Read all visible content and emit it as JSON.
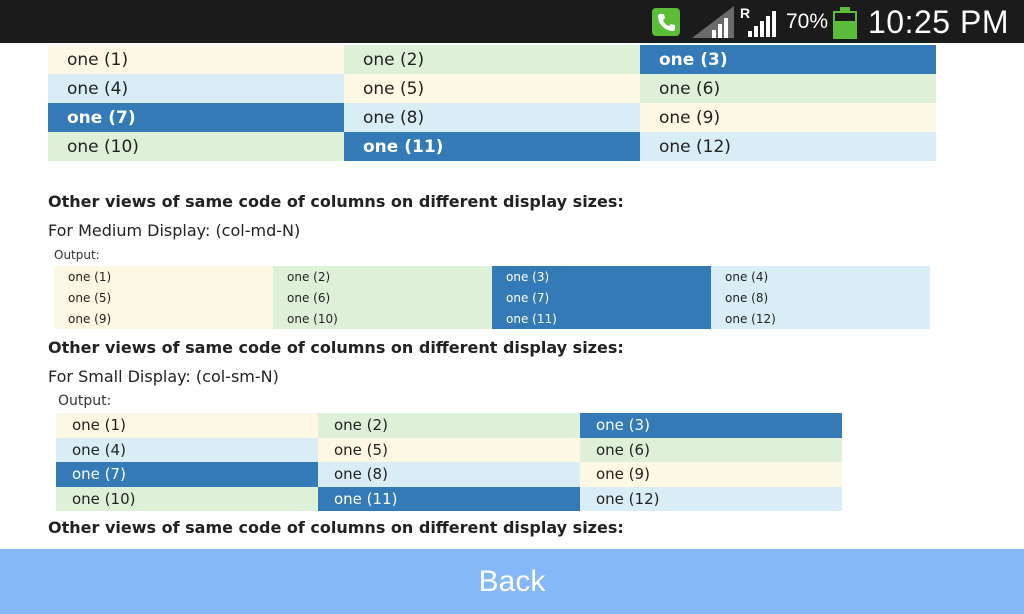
{
  "status_bar": {
    "battery_percent": "70%",
    "time": "10:25 PM",
    "roaming_indicator": "R",
    "icons": [
      "phone-call-icon",
      "wifi-icon",
      "signal-icon",
      "battery-icon"
    ],
    "colors": {
      "background": "#1b1b1b",
      "accent": "#5bbd3a"
    }
  },
  "section1": {
    "grid": [
      {
        "label": "one (1)",
        "style": "cream"
      },
      {
        "label": "one (2)",
        "style": "green"
      },
      {
        "label": "one (3)",
        "style": "dark"
      },
      {
        "label": "one (4)",
        "style": "blue"
      },
      {
        "label": "one (5)",
        "style": "cream"
      },
      {
        "label": "one (6)",
        "style": "green"
      },
      {
        "label": "one (7)",
        "style": "dark"
      },
      {
        "label": "one (8)",
        "style": "blue"
      },
      {
        "label": "one (9)",
        "style": "cream"
      },
      {
        "label": "one (10)",
        "style": "green"
      },
      {
        "label": "one (11)",
        "style": "dark"
      },
      {
        "label": "one (12)",
        "style": "blue"
      }
    ]
  },
  "section2": {
    "heading": "Other views of same code of columns on different display sizes:",
    "subtitle": "For Medium Display: (col-md-N)",
    "output_label": "Output:",
    "grid": [
      {
        "label": "one (1)",
        "style": "cream"
      },
      {
        "label": "one (2)",
        "style": "green"
      },
      {
        "label": "one (3)",
        "style": "dark"
      },
      {
        "label": "one (4)",
        "style": "blue"
      },
      {
        "label": "one (5)",
        "style": "cream"
      },
      {
        "label": "one (6)",
        "style": "green"
      },
      {
        "label": "one (7)",
        "style": "dark"
      },
      {
        "label": "one (8)",
        "style": "blue"
      },
      {
        "label": "one (9)",
        "style": "cream"
      },
      {
        "label": "one (10)",
        "style": "green"
      },
      {
        "label": "one (11)",
        "style": "dark"
      },
      {
        "label": "one (12)",
        "style": "blue"
      }
    ]
  },
  "section3": {
    "heading": "Other views of same code of columns on different display sizes:",
    "subtitle": "For Small Display: (col-sm-N)",
    "output_label": "Output:",
    "grid": [
      {
        "label": "one (1)",
        "style": "cream"
      },
      {
        "label": "one (2)",
        "style": "green"
      },
      {
        "label": "one (3)",
        "style": "dark"
      },
      {
        "label": "one (4)",
        "style": "blue"
      },
      {
        "label": "one (5)",
        "style": "cream"
      },
      {
        "label": "one (6)",
        "style": "green"
      },
      {
        "label": "one (7)",
        "style": "dark"
      },
      {
        "label": "one (8)",
        "style": "blue"
      },
      {
        "label": "one (9)",
        "style": "cream"
      },
      {
        "label": "one (10)",
        "style": "green"
      },
      {
        "label": "one (11)",
        "style": "dark"
      },
      {
        "label": "one (12)",
        "style": "blue"
      }
    ]
  },
  "section4": {
    "heading": "Other views of same code of columns on different display sizes:"
  },
  "back_button": {
    "label": "Back",
    "color": "#84b8f8"
  },
  "cell_colors": {
    "cream": "#fcf8e3",
    "green": "#dff0d8",
    "blue": "#d9edf7",
    "dark": "#337ab7"
  }
}
